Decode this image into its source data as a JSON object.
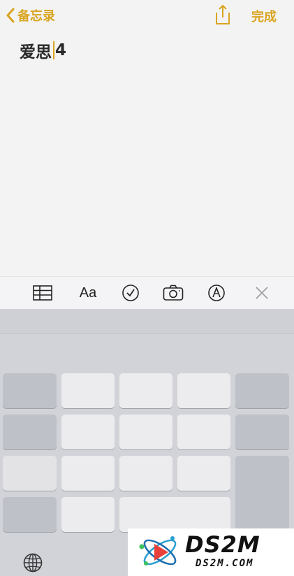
{
  "nav": {
    "back_label": "备忘录",
    "done_label": "完成"
  },
  "note": {
    "text_before_caret": "爱思",
    "text_after_caret": "4"
  },
  "toolbar": {
    "format_label": "Aa",
    "tools": [
      "table-icon",
      "format-icon",
      "checklist-icon",
      "camera-icon",
      "markup-icon",
      "close-icon"
    ]
  },
  "logo": {
    "main": "DS2M",
    "sub": "DS2M.COM"
  },
  "colors": {
    "accent": "#d9a520",
    "keyboard_bg": "#d2d3d8",
    "key_light": "#ececee",
    "key_dark": "#bfc1c9"
  }
}
